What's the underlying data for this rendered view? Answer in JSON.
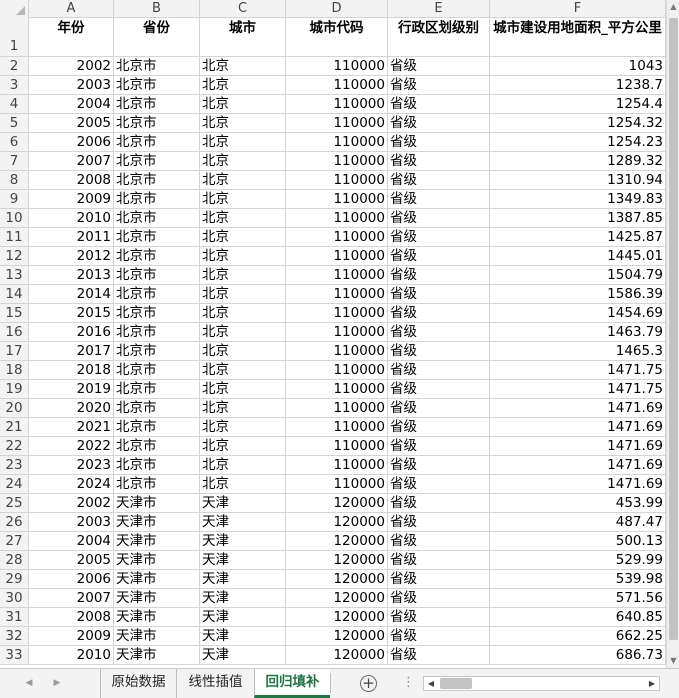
{
  "columns": [
    "A",
    "B",
    "C",
    "D",
    "E",
    "F"
  ],
  "headers": [
    "年份",
    "省份",
    "城市",
    "城市代码",
    "行政区划级别",
    "城市建设用地面积_平方公里"
  ],
  "rows": [
    [
      "1",
      "",
      "",
      "",
      "",
      "",
      ""
    ],
    [
      "2",
      "2002",
      "北京市",
      "北京",
      "110000",
      "省级",
      "1043"
    ],
    [
      "3",
      "2003",
      "北京市",
      "北京",
      "110000",
      "省级",
      "1238.7"
    ],
    [
      "4",
      "2004",
      "北京市",
      "北京",
      "110000",
      "省级",
      "1254.4"
    ],
    [
      "5",
      "2005",
      "北京市",
      "北京",
      "110000",
      "省级",
      "1254.32"
    ],
    [
      "6",
      "2006",
      "北京市",
      "北京",
      "110000",
      "省级",
      "1254.23"
    ],
    [
      "7",
      "2007",
      "北京市",
      "北京",
      "110000",
      "省级",
      "1289.32"
    ],
    [
      "8",
      "2008",
      "北京市",
      "北京",
      "110000",
      "省级",
      "1310.94"
    ],
    [
      "9",
      "2009",
      "北京市",
      "北京",
      "110000",
      "省级",
      "1349.83"
    ],
    [
      "10",
      "2010",
      "北京市",
      "北京",
      "110000",
      "省级",
      "1387.85"
    ],
    [
      "11",
      "2011",
      "北京市",
      "北京",
      "110000",
      "省级",
      "1425.87"
    ],
    [
      "12",
      "2012",
      "北京市",
      "北京",
      "110000",
      "省级",
      "1445.01"
    ],
    [
      "13",
      "2013",
      "北京市",
      "北京",
      "110000",
      "省级",
      "1504.79"
    ],
    [
      "14",
      "2014",
      "北京市",
      "北京",
      "110000",
      "省级",
      "1586.39"
    ],
    [
      "15",
      "2015",
      "北京市",
      "北京",
      "110000",
      "省级",
      "1454.69"
    ],
    [
      "16",
      "2016",
      "北京市",
      "北京",
      "110000",
      "省级",
      "1463.79"
    ],
    [
      "17",
      "2017",
      "北京市",
      "北京",
      "110000",
      "省级",
      "1465.3"
    ],
    [
      "18",
      "2018",
      "北京市",
      "北京",
      "110000",
      "省级",
      "1471.75"
    ],
    [
      "19",
      "2019",
      "北京市",
      "北京",
      "110000",
      "省级",
      "1471.75"
    ],
    [
      "20",
      "2020",
      "北京市",
      "北京",
      "110000",
      "省级",
      "1471.69"
    ],
    [
      "21",
      "2021",
      "北京市",
      "北京",
      "110000",
      "省级",
      "1471.69"
    ],
    [
      "22",
      "2022",
      "北京市",
      "北京",
      "110000",
      "省级",
      "1471.69"
    ],
    [
      "23",
      "2023",
      "北京市",
      "北京",
      "110000",
      "省级",
      "1471.69"
    ],
    [
      "24",
      "2024",
      "北京市",
      "北京",
      "110000",
      "省级",
      "1471.69"
    ],
    [
      "25",
      "2002",
      "天津市",
      "天津",
      "120000",
      "省级",
      "453.99"
    ],
    [
      "26",
      "2003",
      "天津市",
      "天津",
      "120000",
      "省级",
      "487.47"
    ],
    [
      "27",
      "2004",
      "天津市",
      "天津",
      "120000",
      "省级",
      "500.13"
    ],
    [
      "28",
      "2005",
      "天津市",
      "天津",
      "120000",
      "省级",
      "529.99"
    ],
    [
      "29",
      "2006",
      "天津市",
      "天津",
      "120000",
      "省级",
      "539.98"
    ],
    [
      "30",
      "2007",
      "天津市",
      "天津",
      "120000",
      "省级",
      "571.56"
    ],
    [
      "31",
      "2008",
      "天津市",
      "天津",
      "120000",
      "省级",
      "640.85"
    ],
    [
      "32",
      "2009",
      "天津市",
      "天津",
      "120000",
      "省级",
      "662.25"
    ],
    [
      "33",
      "2010",
      "天津市",
      "天津",
      "120000",
      "省级",
      "686.73"
    ]
  ],
  "sheets": [
    {
      "name": "原始数据",
      "active": false
    },
    {
      "name": "线性插值",
      "active": false
    },
    {
      "name": "回归填补",
      "active": true
    }
  ],
  "icons": {
    "add_sheet": "+",
    "nav_prev": "◀",
    "nav_next": "▶",
    "options": "⋮",
    "scroll_up": "▲",
    "scroll_down": "▼",
    "scroll_left": "◀",
    "scroll_right": "▶"
  },
  "colors": {
    "accent": "#217346",
    "grid_line": "#d4d4d4",
    "header_bg": "#f3f3f3"
  }
}
